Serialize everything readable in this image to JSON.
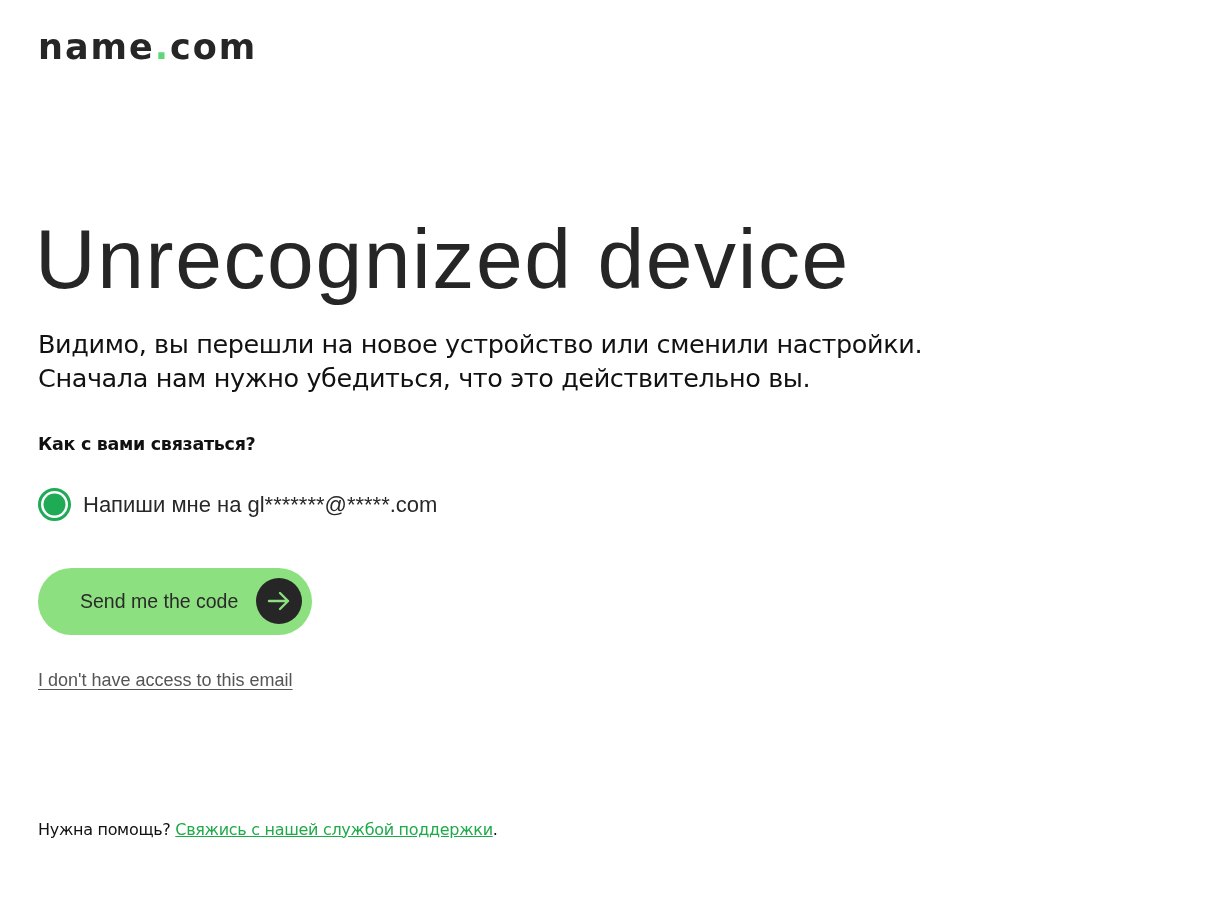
{
  "logo": {
    "name_part": "name",
    "dot": ".",
    "tld_part": "com"
  },
  "heading": "Unrecognized device",
  "intro_lines": [
    "Видимо, вы перешли на новое устройство или сменили настройки.",
    "Сначала нам нужно убедиться, что это действительно вы."
  ],
  "contact_question": "Как с вами связаться?",
  "contact_options": [
    {
      "label": "Напиши мне на gl*******@*****.com",
      "selected": true
    }
  ],
  "submit_button": {
    "label": "Send me the code"
  },
  "no_access_link": "I don't have access to this email",
  "help": {
    "text": "Нужна помощь?",
    "link": "Свяжись с нашей службой поддержки",
    "end": "."
  }
}
